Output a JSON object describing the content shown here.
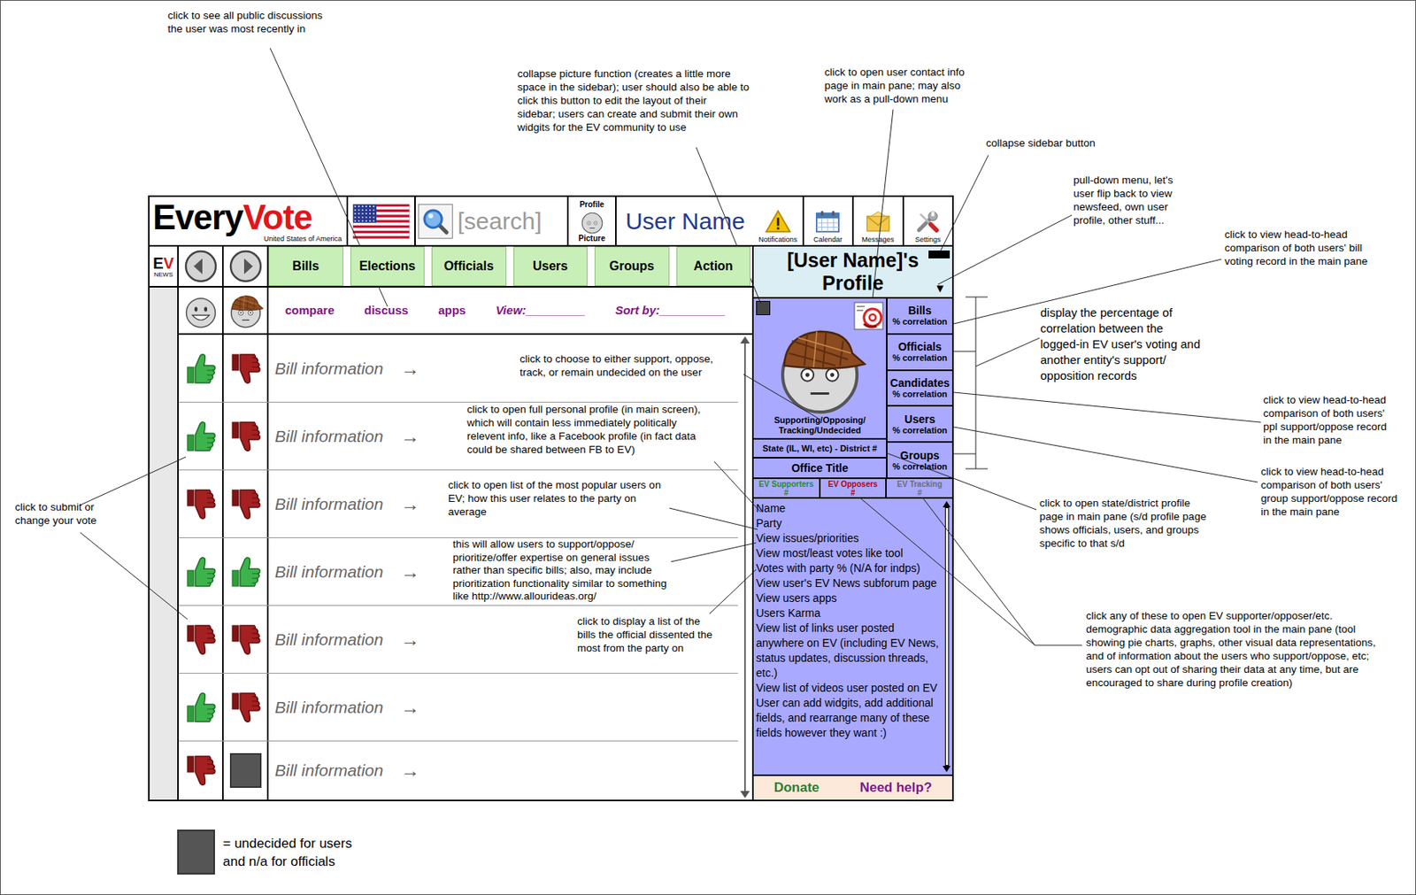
{
  "header": {
    "logo": {
      "first": "Every",
      "second": "Vote",
      "subtitle": "United States of America"
    },
    "search": {
      "placeholder": "[search]"
    },
    "profile_picture": {
      "top": "Profile",
      "bottom": "Picture"
    },
    "user_name": "User Name",
    "toolbar": [
      {
        "label": "Notifications",
        "kind": "warning"
      },
      {
        "label": "Calendar",
        "kind": "calendar"
      },
      {
        "label": "Messages",
        "kind": "messages"
      },
      {
        "label": "Settings",
        "kind": "settings"
      }
    ]
  },
  "ev_news": {
    "e": "E",
    "v": "V",
    "label": "NEWS"
  },
  "tabs": [
    {
      "label": "Bills"
    },
    {
      "label": "Elections"
    },
    {
      "label": "Officials"
    },
    {
      "label": "Users"
    },
    {
      "label": "Groups"
    },
    {
      "label": "Action"
    }
  ],
  "subnav": {
    "links": [
      "compare",
      "discuss",
      "apps"
    ],
    "view": "View:_________",
    "sort": "Sort by:__________"
  },
  "bills": [
    {
      "text": "Bill information",
      "arrow": "→",
      "user_vote": "up",
      "official_vote": "down"
    },
    {
      "text": "Bill information",
      "arrow": "→",
      "user_vote": "up",
      "official_vote": "down"
    },
    {
      "text": "Bill information",
      "arrow": "→",
      "user_vote": "down",
      "official_vote": "down"
    },
    {
      "text": "Bill information",
      "arrow": "→",
      "user_vote": "up",
      "official_vote": "up"
    },
    {
      "text": "Bill information",
      "arrow": "→",
      "user_vote": "down",
      "official_vote": "down"
    },
    {
      "text": "Bill information",
      "arrow": "→",
      "user_vote": "up",
      "official_vote": "down"
    },
    {
      "text": "Bill information",
      "arrow": "→",
      "user_vote": "down",
      "official_vote": "undecided"
    }
  ],
  "sidebar": {
    "title": "[User Name]'s Profile",
    "menu_arrow": "▼",
    "stance": [
      "Supporting/Opposing/",
      "Tracking/Undecided"
    ],
    "district": "State (IL, WI, etc) - District #",
    "office": "Office Title",
    "correlations": [
      {
        "label": "Bills",
        "sub": "% correlation"
      },
      {
        "label": "Officials",
        "sub": "% correlation"
      },
      {
        "label": "Candidates",
        "sub": "% correlation"
      },
      {
        "label": "Users",
        "sub": "% correlation"
      },
      {
        "label": "Groups",
        "sub": "% correlation"
      }
    ],
    "counts": [
      {
        "label": "EV Supporters",
        "value": "#",
        "color": "#1f8f1f"
      },
      {
        "label": "EV Opposers",
        "value": "#",
        "color": "#c00000"
      },
      {
        "label": "EV Tracking",
        "value": "#",
        "color": "#6e6e6e"
      }
    ],
    "fields": [
      "Name",
      "Party",
      "View issues/priorities",
      "View most/least votes like tool",
      "Votes with party % (N/A for indps)",
      "View user's EV News subforum page",
      "View users apps",
      "Users Karma",
      "View list of links user posted anywhere on EV (including EV News, status updates, discussion threads, etc.)",
      "View list of videos user posted on EV",
      "User can add widgits, add additional fields, and rearrange many of these fields however they want :)"
    ],
    "footer": {
      "donate": "Donate",
      "help": "Need help?"
    }
  },
  "annotations": [
    {
      "lines": [
        "click to see all public discussions",
        "the user was most recently in"
      ]
    },
    {
      "lines": [
        "collapse picture function (creates a little more",
        "space in the sidebar); user should also be able to",
        "click this button to edit the layout of their",
        "sidebar; users can create and submit their own",
        "widgits for the EV community to use"
      ]
    },
    {
      "lines": [
        "click to open user contact info",
        "page in main pane; may also",
        "work as a pull-down menu"
      ]
    },
    {
      "lines": [
        "collapse sidebar button"
      ]
    },
    {
      "lines": [
        "pull-down menu, let's",
        "user flip back to view",
        "newsfeed, own user",
        "profile, other stuff..."
      ]
    },
    {
      "lines": [
        "click to view head-to-head",
        "comparison of both users' bill",
        "voting record in the main pane"
      ]
    },
    {
      "lines": [
        "display the percentage of",
        "correlation between the",
        "logged-in EV user's voting and",
        "another entity's support/",
        "opposition records"
      ]
    },
    {
      "lines": [
        "click to view head-to-head",
        "comparison of both users'",
        "ppl support/oppose record",
        "in the main pane"
      ]
    },
    {
      "lines": [
        "click to view head-to-head",
        "comparison of both users'",
        "group support/oppose record",
        "in the main pane"
      ]
    },
    {
      "lines": [
        "click to open state/district profile",
        "page in main pane (s/d profile page",
        "shows officials, users, and groups",
        "specific to that s/d"
      ]
    },
    {
      "lines": [
        "click any of these to open EV supporter/opposer/etc.",
        "demographic data aggregation tool in the main pane (tool",
        "showing pie charts, graphs, other visual data representations,",
        "and of information about the users who support/oppose, etc;",
        "users can opt out of sharing their data at any time, but are",
        "encouraged to share during profile creation)"
      ]
    },
    {
      "lines": [
        "click to choose to either support, oppose,",
        "track, or remain undecided on the user"
      ]
    },
    {
      "lines": [
        "click to open full personal profile (in main screen),",
        "which will contain less immediately politically",
        "relevent info, like a Facebook profile (in fact data",
        "could be shared between FB to EV)"
      ]
    },
    {
      "lines": [
        "click to open list of the most popular users on",
        "EV; how this user relates to the party on",
        "average"
      ]
    },
    {
      "lines": [
        "this will allow users to support/oppose/",
        "prioritize/offer expertise on general issues",
        "rather than specific bills; also, may include",
        "prioritization functionality similar to something",
        "like http://www.allourideas.org/"
      ]
    },
    {
      "lines": [
        "click to display a list of the",
        "bills the official dissented the",
        "most from the party on"
      ]
    },
    {
      "lines": [
        "click to submit or",
        "change your vote"
      ]
    }
  ],
  "legend": {
    "lines": [
      "= undecided for users",
      "and n/a for officials"
    ]
  }
}
